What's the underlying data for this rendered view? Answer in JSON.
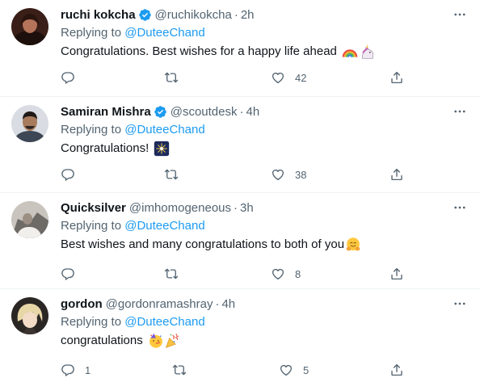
{
  "tweets": [
    {
      "name": "ruchi kokcha",
      "verified": true,
      "handle": "@ruchikokcha",
      "dot": "·",
      "time": "2h",
      "replying_prefix": "Replying to",
      "replying_to": "@DuteeChand",
      "text": "Congratulations. Best wishes for a happy life ahead",
      "emojis": [
        "rainbow-emoji",
        "unicorn-emoji"
      ],
      "reply_count": "",
      "retweet_count": "",
      "like_count": "42"
    },
    {
      "name": "Samiran Mishra",
      "verified": true,
      "handle": "@scoutdesk",
      "dot": "·",
      "time": "4h",
      "replying_prefix": "Replying to",
      "replying_to": "@DuteeChand",
      "text": "Congratulations!",
      "emojis": [
        "sparkler-emoji"
      ],
      "reply_count": "",
      "retweet_count": "",
      "like_count": "38"
    },
    {
      "name": "Quicksilver",
      "verified": false,
      "handle": "@imhomogeneous",
      "dot": "·",
      "time": "3h",
      "replying_prefix": "Replying to",
      "replying_to": "@DuteeChand",
      "text": "Best wishes and many congratulations to both of you",
      "emojis": [
        "hugging-face-emoji"
      ],
      "reply_count": "",
      "retweet_count": "",
      "like_count": "8"
    },
    {
      "name": "gordon",
      "verified": false,
      "handle": "@gordonramashray",
      "dot": "·",
      "time": "4h",
      "replying_prefix": "Replying to",
      "replying_to": "@DuteeChand",
      "text": "congratulations",
      "emojis": [
        "partying-face-emoji",
        "party-popper-emoji"
      ],
      "reply_count": "1",
      "retweet_count": "",
      "like_count": "5"
    }
  ],
  "colors": {
    "primary_text": "#0f1419",
    "secondary_text": "#536471",
    "link": "#1d9bf0",
    "divider": "#eff3f4"
  }
}
